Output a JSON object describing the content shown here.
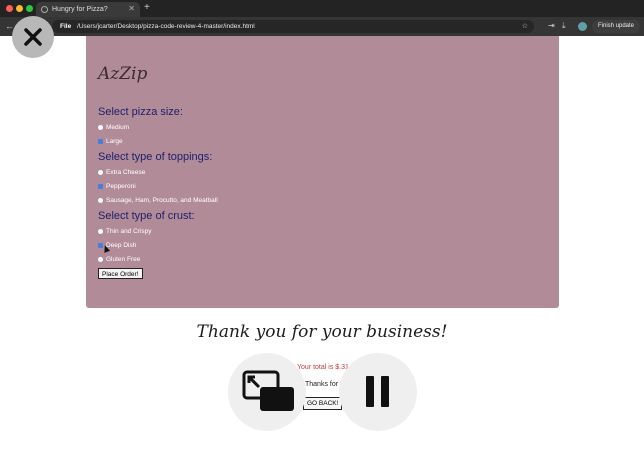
{
  "browser": {
    "tab_title": "Hungry for Pizza?",
    "new_tab": "+",
    "url_scheme": "File",
    "url": "/Users/jcarter/Desktop/pizza-code-review-4-master/index.html",
    "finish_update": "Finish update",
    "back": "←",
    "forward": "→"
  },
  "page": {
    "logo": "AzZip",
    "size_heading": "Select pizza size:",
    "sizes": [
      {
        "label": "Medium",
        "checked": false
      },
      {
        "label": "Large",
        "checked": true
      }
    ],
    "toppings_heading": "Select type of toppings:",
    "toppings": [
      {
        "label": "Extra Cheese",
        "checked": false
      },
      {
        "label": "Pepperoni",
        "checked": true
      },
      {
        "label": "Sausage, Ham, Procutto, and Meatball",
        "checked": false
      }
    ],
    "crust_heading": "Select type of crust:",
    "crusts": [
      {
        "label": "Thin and Crispy",
        "checked": false
      },
      {
        "label": "Deep Dish",
        "checked": true
      },
      {
        "label": "Gluten Free",
        "checked": false
      }
    ],
    "place_order": "Place Order!",
    "thanks": "Thank you for your business!",
    "total": "Your total is $.31",
    "thanks_more": "Thanks for further",
    "go_back": "GO BACK!"
  },
  "colors": {
    "panel": "#b18c98",
    "heading": "#1d1e6c",
    "total": "#c23b3b"
  },
  "overlay": {
    "close_icon": "close-icon",
    "pip_icon": "picture-in-picture-icon",
    "pause_icon": "pause-icon"
  }
}
